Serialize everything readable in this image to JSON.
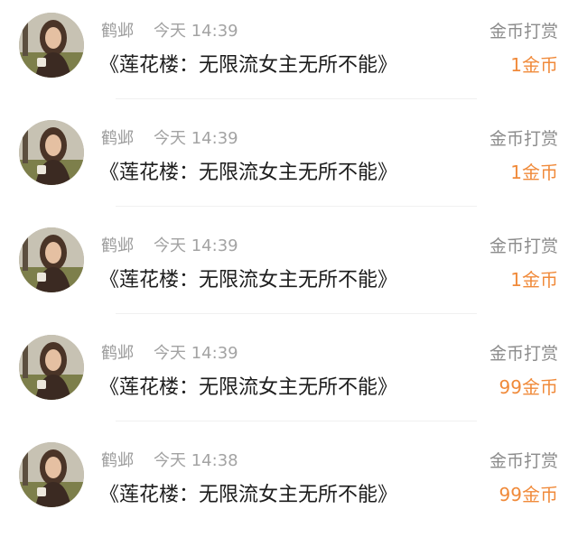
{
  "rows": [
    {
      "user": "鹤邺",
      "time": "今天 14:39",
      "title": "《莲花楼：无限流女主无所不能》",
      "reward_label": "金币打赏",
      "amount": "1金币"
    },
    {
      "user": "鹤邺",
      "time": "今天 14:39",
      "title": "《莲花楼：无限流女主无所不能》",
      "reward_label": "金币打赏",
      "amount": "1金币"
    },
    {
      "user": "鹤邺",
      "time": "今天 14:39",
      "title": "《莲花楼：无限流女主无所不能》",
      "reward_label": "金币打赏",
      "amount": "1金币"
    },
    {
      "user": "鹤邺",
      "time": "今天 14:39",
      "title": "《莲花楼：无限流女主无所不能》",
      "reward_label": "金币打赏",
      "amount": "99金币"
    },
    {
      "user": "鹤邺",
      "time": "今天 14:38",
      "title": "《莲花楼：无限流女主无所不能》",
      "reward_label": "金币打赏",
      "amount": "99金币"
    }
  ],
  "colors": {
    "amount": "#f08a3a",
    "meta": "#9b9b9b",
    "title": "#1c1c1c"
  }
}
